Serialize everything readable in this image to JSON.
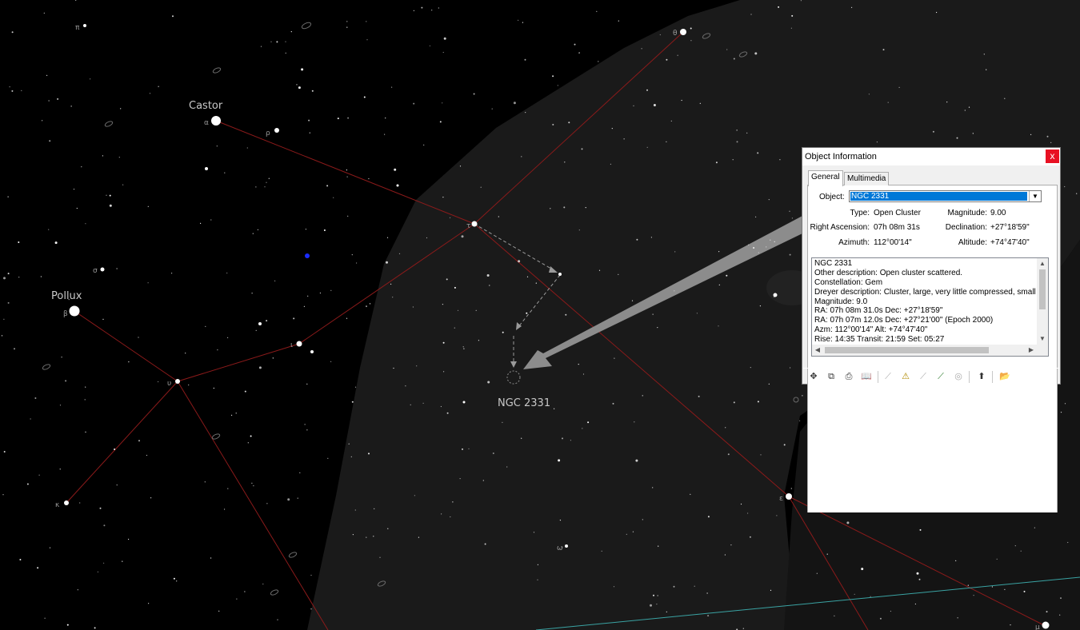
{
  "sky": {
    "labels": {
      "castor": "Castor",
      "pollux": "Pollux",
      "target": "NGC 2331"
    },
    "greek": {
      "theta": "θ",
      "alpha": "α",
      "rho": "ρ",
      "tau": "τ",
      "sigma": "σ",
      "beta": "β",
      "iota": "ι",
      "upsilon": "υ",
      "kappa": "κ",
      "epsilon": "ε",
      "mu": "μ",
      "omega": "ω",
      "pi": "π"
    },
    "colors": {
      "background": "#000000",
      "milky_way": "#1a1a1a",
      "constellation_line": "#8b1a1a",
      "ecliptic": "#3aa3a3",
      "pointer": "#8c8c8c"
    }
  },
  "object_info": {
    "title": "Object Information",
    "close_label": "x",
    "tabs": [
      "General",
      "Multimedia"
    ],
    "object_label": "Object:",
    "object_value": "NGC 2331",
    "fields": {
      "type_label": "Type:",
      "type_value": "Open Cluster",
      "magnitude_label": "Magnitude:",
      "magnitude_value": "9.00",
      "ra_label": "Right Ascension:",
      "ra_value": "07h 08m 31s",
      "dec_label": "Declination:",
      "dec_value": "+27°18'59\"",
      "az_label": "Azimuth:",
      "az_value": "112°00'14\"",
      "alt_label": "Altitude:",
      "alt_value": "+74°47'40\""
    },
    "description_lines": [
      "NGC 2331",
      "Other description: Open cluster scattered.",
      "Constellation:  Gem",
      "Dreyer description: Cluster, large, very little compressed, small clus",
      "Magnitude:  9.0",
      "RA: 07h 08m 31.0s  Dec: +27°18'59\"",
      "RA: 07h 07m 12.0s  Dec: +27°21'00\"  (Epoch 2000)",
      "Azm: 112°00'14\"  Alt: +74°47'40\"",
      "Rise: 14:35  Transit: 21:59  Set: 05:27"
    ],
    "toolbar_icons": [
      "center-icon",
      "copy-icon",
      "print-icon",
      "book-icon",
      "telescope-dim-icon",
      "telescope-warn-icon",
      "telescope-dim2-icon",
      "telescope-go-icon",
      "galaxy-dim-icon",
      "up-arrow-icon",
      "open-folder-icon"
    ]
  }
}
